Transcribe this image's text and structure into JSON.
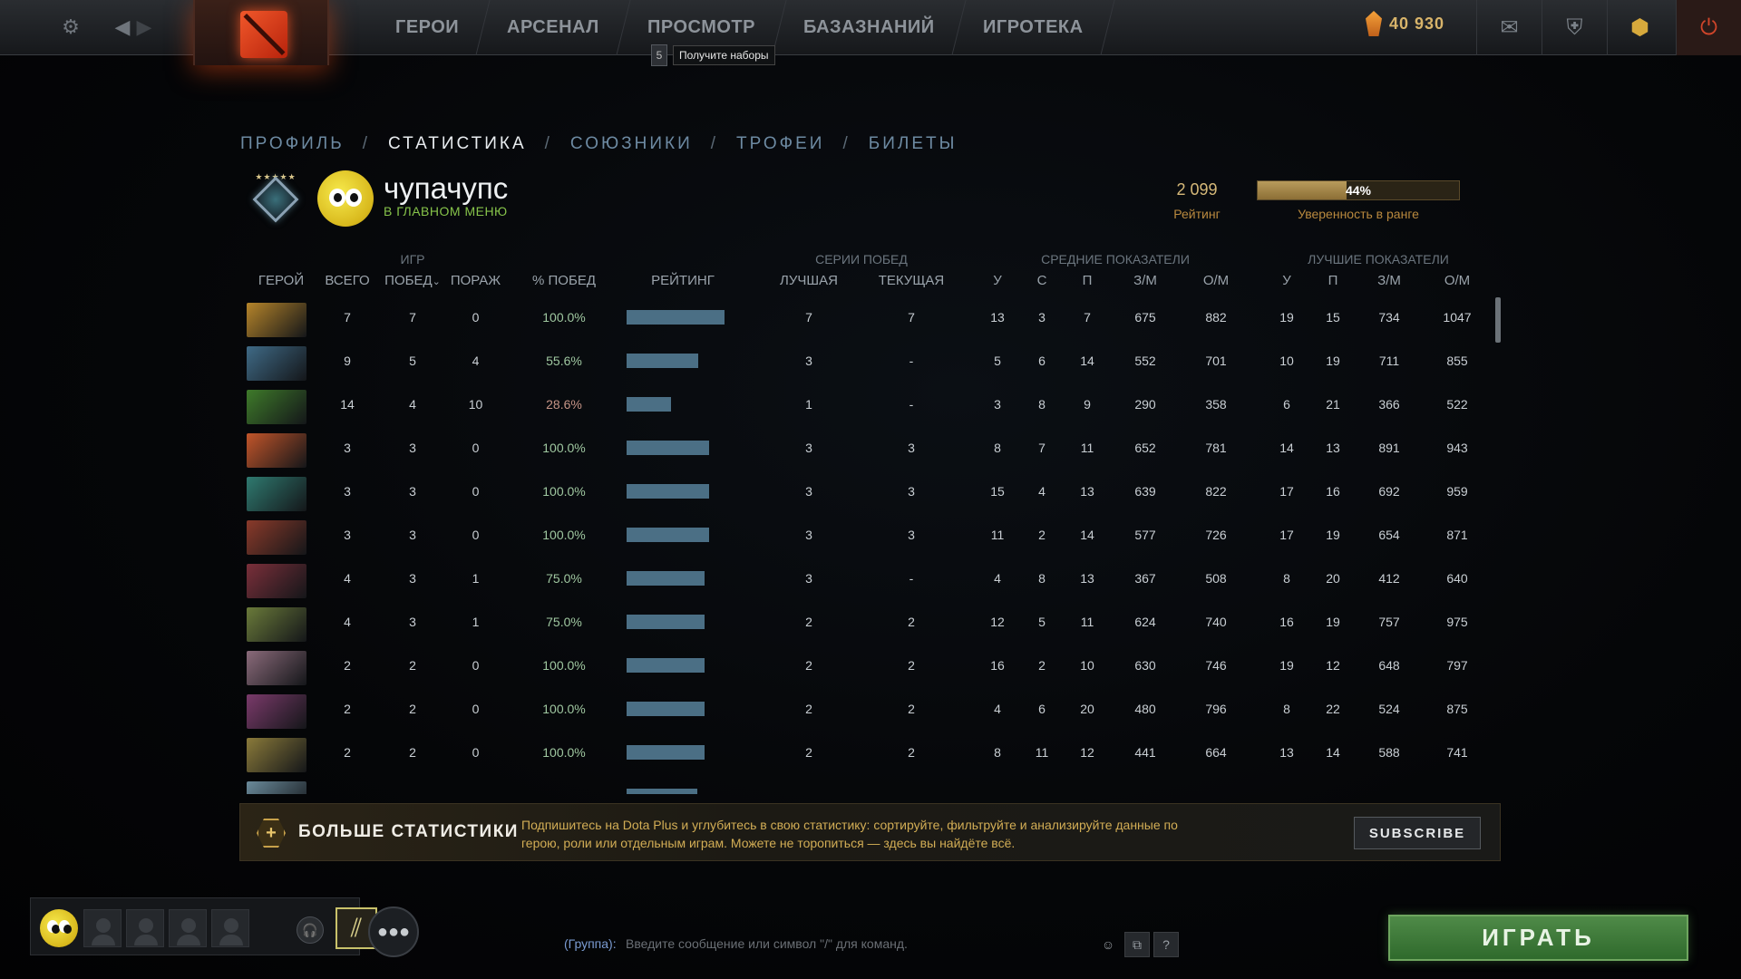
{
  "topbar": {
    "nav": [
      "ГЕРОИ",
      "АРСЕНАЛ",
      "ПРОСМОТР",
      "БАЗАЗНАНИЙ",
      "ИГРОТЕКА"
    ],
    "tooltip_count": "5",
    "tooltip_text": "Получите наборы",
    "shards": "40 930",
    "icons": [
      "gear-icon",
      "back-arrow-icon",
      "forward-arrow-icon",
      "mail-icon",
      "armory-icon",
      "dota-plus-icon",
      "power-icon"
    ]
  },
  "tabs": {
    "profile": "ПРОФИЛЬ",
    "stats": "СТАТИСТИКА",
    "allies": "СОЮЗНИКИ",
    "trophies": "ТРОФЕИ",
    "tickets": "БИЛЕТЫ",
    "separator": "/"
  },
  "player": {
    "name": "чупачупс",
    "status": "В ГЛАВНОМ МЕНЮ",
    "rating": "2 099",
    "rating_label": "Рейтинг",
    "confidence": "44%",
    "confidence_value": 0.44,
    "confidence_label": "Уверенность в ранге",
    "medal_stars": "★★★★★"
  },
  "table": {
    "groups": {
      "games": "ИГР",
      "streaks": "СЕРИИ ПОБЕД",
      "avg": "СРЕДНИЕ ПОКАЗАТЕЛИ",
      "best": "ЛУЧШИЕ ПОКАЗАТЕЛИ"
    },
    "headers": {
      "hero": "ГЕРОЙ",
      "total": "ВСЕГО",
      "wins": "ПОБЕД",
      "wins_sort": "⌄",
      "losses": "ПОРАЖ",
      "winrate": "% ПОБЕД",
      "rating": "РЕЙТИНГ",
      "best_streak": "ЛУЧШАЯ",
      "current_streak": "ТЕКУЩАЯ",
      "avg_k": "У",
      "avg_d": "С",
      "avg_a": "П",
      "avg_gpm": "З/М",
      "avg_xpm": "О/М",
      "best_k": "У",
      "best_a": "П",
      "best_gpm": "З/М",
      "best_xpm": "О/М"
    },
    "rows": [
      {
        "hero_color": "#b5842a",
        "total": "7",
        "wins": "7",
        "losses": "0",
        "winrate": "100.0%",
        "rating_bar": 1.0,
        "best_streak": "7",
        "current_streak": "7",
        "avg_k": "13",
        "avg_d": "3",
        "avg_a": "7",
        "avg_gpm": "675",
        "avg_xpm": "882",
        "best_k": "19",
        "best_a": "15",
        "best_gpm": "734",
        "best_xpm": "1047"
      },
      {
        "hero_color": "#3f6a86",
        "total": "9",
        "wins": "5",
        "losses": "4",
        "winrate": "55.6%",
        "rating_bar": 0.73,
        "best_streak": "3",
        "current_streak": "-",
        "avg_k": "5",
        "avg_d": "6",
        "avg_a": "14",
        "avg_gpm": "552",
        "avg_xpm": "701",
        "best_k": "10",
        "best_a": "19",
        "best_gpm": "711",
        "best_xpm": "855"
      },
      {
        "hero_color": "#3e7a2a",
        "total": "14",
        "wins": "4",
        "losses": "10",
        "winrate": "28.6%",
        "rating_bar": 0.45,
        "best_streak": "1",
        "current_streak": "-",
        "avg_k": "3",
        "avg_d": "8",
        "avg_a": "9",
        "avg_gpm": "290",
        "avg_xpm": "358",
        "best_k": "6",
        "best_a": "21",
        "best_gpm": "366",
        "best_xpm": "522"
      },
      {
        "hero_color": "#c2552a",
        "total": "3",
        "wins": "3",
        "losses": "0",
        "winrate": "100.0%",
        "rating_bar": 0.84,
        "best_streak": "3",
        "current_streak": "3",
        "avg_k": "8",
        "avg_d": "7",
        "avg_a": "11",
        "avg_gpm": "652",
        "avg_xpm": "781",
        "best_k": "14",
        "best_a": "13",
        "best_gpm": "891",
        "best_xpm": "943"
      },
      {
        "hero_color": "#2f7a70",
        "total": "3",
        "wins": "3",
        "losses": "0",
        "winrate": "100.0%",
        "rating_bar": 0.84,
        "best_streak": "3",
        "current_streak": "3",
        "avg_k": "15",
        "avg_d": "4",
        "avg_a": "13",
        "avg_gpm": "639",
        "avg_xpm": "822",
        "best_k": "17",
        "best_a": "16",
        "best_gpm": "692",
        "best_xpm": "959"
      },
      {
        "hero_color": "#8a3a2a",
        "total": "3",
        "wins": "3",
        "losses": "0",
        "winrate": "100.0%",
        "rating_bar": 0.84,
        "best_streak": "3",
        "current_streak": "3",
        "avg_k": "11",
        "avg_d": "2",
        "avg_a": "14",
        "avg_gpm": "577",
        "avg_xpm": "726",
        "best_k": "17",
        "best_a": "19",
        "best_gpm": "654",
        "best_xpm": "871"
      },
      {
        "hero_color": "#7a2f3a",
        "total": "4",
        "wins": "3",
        "losses": "1",
        "winrate": "75.0%",
        "rating_bar": 0.8,
        "best_streak": "3",
        "current_streak": "-",
        "avg_k": "4",
        "avg_d": "8",
        "avg_a": "13",
        "avg_gpm": "367",
        "avg_xpm": "508",
        "best_k": "8",
        "best_a": "20",
        "best_gpm": "412",
        "best_xpm": "640"
      },
      {
        "hero_color": "#6a7a3a",
        "total": "4",
        "wins": "3",
        "losses": "1",
        "winrate": "75.0%",
        "rating_bar": 0.8,
        "best_streak": "2",
        "current_streak": "2",
        "avg_k": "12",
        "avg_d": "5",
        "avg_a": "11",
        "avg_gpm": "624",
        "avg_xpm": "740",
        "best_k": "16",
        "best_a": "19",
        "best_gpm": "757",
        "best_xpm": "975"
      },
      {
        "hero_color": "#8a6a7a",
        "total": "2",
        "wins": "2",
        "losses": "0",
        "winrate": "100.0%",
        "rating_bar": 0.8,
        "best_streak": "2",
        "current_streak": "2",
        "avg_k": "16",
        "avg_d": "2",
        "avg_a": "10",
        "avg_gpm": "630",
        "avg_xpm": "746",
        "best_k": "19",
        "best_a": "12",
        "best_gpm": "648",
        "best_xpm": "797"
      },
      {
        "hero_color": "#7a3a6a",
        "total": "2",
        "wins": "2",
        "losses": "0",
        "winrate": "100.0%",
        "rating_bar": 0.8,
        "best_streak": "2",
        "current_streak": "2",
        "avg_k": "4",
        "avg_d": "6",
        "avg_a": "20",
        "avg_gpm": "480",
        "avg_xpm": "796",
        "best_k": "8",
        "best_a": "22",
        "best_gpm": "524",
        "best_xpm": "875"
      },
      {
        "hero_color": "#8a7a3a",
        "total": "2",
        "wins": "2",
        "losses": "0",
        "winrate": "100.0%",
        "rating_bar": 0.8,
        "best_streak": "2",
        "current_streak": "2",
        "avg_k": "8",
        "avg_d": "11",
        "avg_a": "12",
        "avg_gpm": "441",
        "avg_xpm": "664",
        "best_k": "13",
        "best_a": "14",
        "best_gpm": "588",
        "best_xpm": "741"
      },
      {
        "hero_color": "#6a8a9a",
        "total": "",
        "wins": "",
        "losses": "",
        "winrate": "",
        "rating_bar": 0.72,
        "best_streak": "",
        "current_streak": "",
        "avg_k": "",
        "avg_d": "",
        "avg_a": "",
        "avg_gpm": "",
        "avg_xpm": "",
        "best_k": "",
        "best_a": "",
        "best_gpm": "",
        "best_xpm": ""
      }
    ]
  },
  "dota_plus": {
    "title": "БОЛЬШЕ СТАТИСТИКИ",
    "text": "Подпишитесь на Dota Plus и углубитесь в свою статистику: сортируйте, фильтруйте и анализируйте данные по герою, роли или отдельным играм. Можете не торопиться — здесь вы найдёте всё.",
    "button": "SUBSCRIBE"
  },
  "bottombar": {
    "chat_prefix": "(Группа):",
    "chat_placeholder": "Введите сообщение или символ \"/\" для команд.",
    "help": "?",
    "play": "ИГРАТЬ"
  }
}
